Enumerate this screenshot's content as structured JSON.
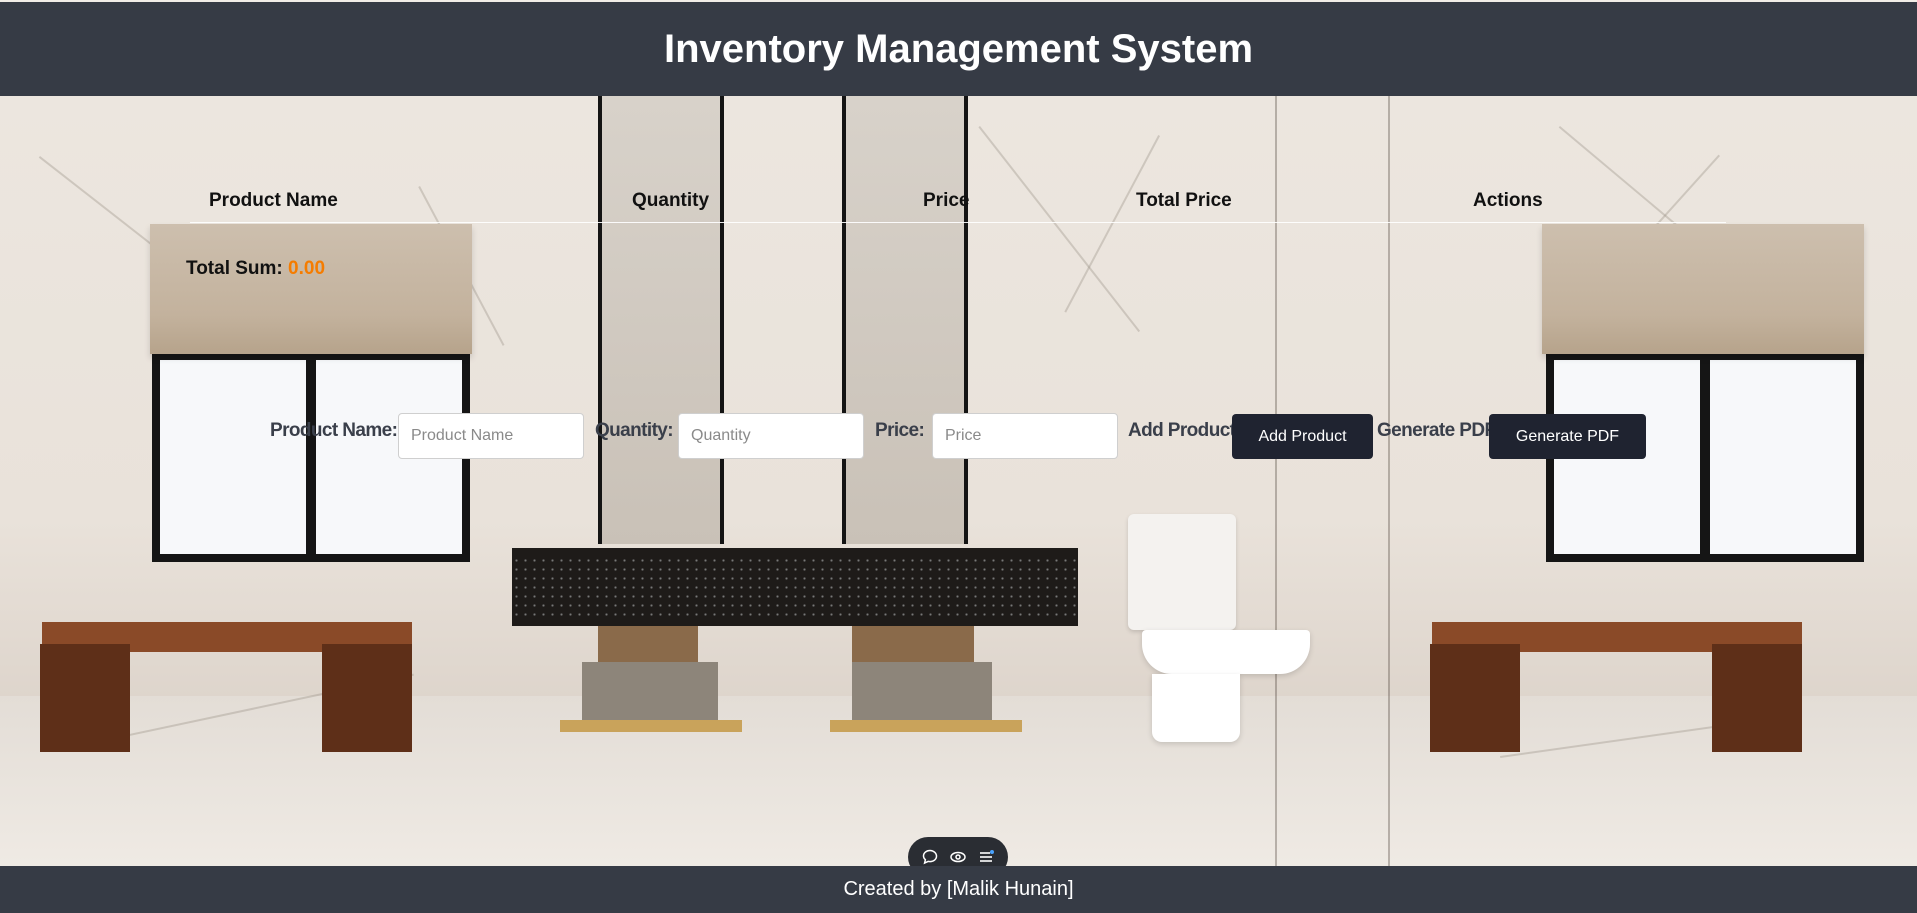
{
  "header": {
    "title": "Inventory Management System"
  },
  "table": {
    "columns": [
      "Product Name",
      "Quantity",
      "Price",
      "Total Price",
      "Actions"
    ]
  },
  "summary": {
    "label": "Total Sum:",
    "value": "0.00"
  },
  "form": {
    "product_name_label": "Product Name:",
    "product_name_placeholder": "Product Name",
    "quantity_label": "Quantity:",
    "quantity_placeholder": "Quantity",
    "price_label": "Price:",
    "price_placeholder": "Price",
    "add_label": "Add Product",
    "add_button": "Add Product",
    "pdf_label": "Generate PDF",
    "pdf_button": "Generate PDF"
  },
  "footer": {
    "text": "Created by [Malik Hunain]"
  },
  "toolbar": {
    "icons": [
      "chat-icon",
      "eye-icon",
      "menu-icon"
    ]
  },
  "colors": {
    "bar": "#363b45",
    "button": "#1f2330",
    "accent": "#f57c00"
  }
}
